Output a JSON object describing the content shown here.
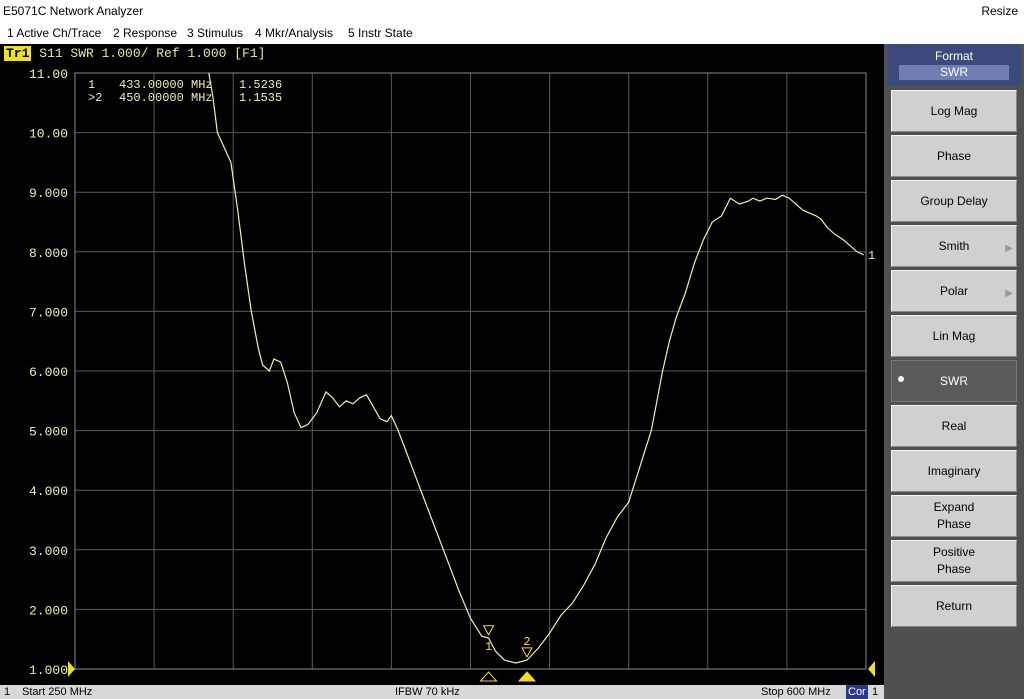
{
  "window": {
    "title": "E5071C Network Analyzer",
    "resize_label": "Resize"
  },
  "menu": [
    "1 Active Ch/Trace",
    "2 Response",
    "3 Stimulus",
    "4 Mkr/Analysis",
    "5 Instr State"
  ],
  "trace": {
    "badge": "Tr1",
    "label": "S11 SWR 1.000/ Ref 1.000 [F1]"
  },
  "markers": [
    {
      "prefix": "1",
      "freq": "433.00000 MHz",
      "value": "1.5236"
    },
    {
      "prefix": ">2",
      "freq": "450.00000 MHz",
      "value": "1.1535"
    }
  ],
  "marker_labels": [
    "1",
    "2"
  ],
  "trace_end_label": "1",
  "status": {
    "channel": "1",
    "start": "Start 250 MHz",
    "ifbw": "IFBW 70 kHz",
    "stop": "Stop 600 MHz",
    "cor": "Cor",
    "channel_end": "1"
  },
  "softkeys": {
    "title": "Format",
    "selected": "SWR",
    "items": [
      {
        "label": "Log Mag",
        "submenu": false,
        "active": false
      },
      {
        "label": "Phase",
        "submenu": false,
        "active": false
      },
      {
        "label": "Group Delay",
        "submenu": false,
        "active": false
      },
      {
        "label": "Smith",
        "submenu": true,
        "active": false
      },
      {
        "label": "Polar",
        "submenu": true,
        "active": false
      },
      {
        "label": "Lin Mag",
        "submenu": false,
        "active": false
      },
      {
        "label": "SWR",
        "submenu": false,
        "active": true
      },
      {
        "label": "Real",
        "submenu": false,
        "active": false
      },
      {
        "label": "Imaginary",
        "submenu": false,
        "active": false
      },
      {
        "label": "Expand\nPhase",
        "submenu": false,
        "active": false
      },
      {
        "label": "Positive\nPhase",
        "submenu": false,
        "active": false
      },
      {
        "label": "Return",
        "submenu": false,
        "active": false
      }
    ]
  },
  "colors": {
    "trace": "#f0f0b0",
    "grid": "#5a5a5a",
    "marker": "#f0e020",
    "background": "#000000"
  },
  "chart_data": {
    "type": "line",
    "xlim": [
      250,
      600
    ],
    "ylim": [
      1,
      11
    ],
    "y_ticks": [
      "1.000",
      "2.000",
      "3.000",
      "4.000",
      "5.000",
      "6.000",
      "7.000",
      "8.000",
      "9.000",
      "10.00",
      "11.00"
    ],
    "series": [
      {
        "x": [
          309,
          311,
          313,
          316,
          319,
          322,
          325,
          328,
          331,
          333,
          336,
          338,
          341,
          344,
          347,
          350,
          353,
          357,
          361,
          364,
          367,
          370,
          373,
          376,
          379,
          382,
          385,
          388,
          390,
          393,
          396,
          400,
          405,
          410,
          415,
          420,
          425,
          430,
          433,
          436,
          440,
          445,
          450,
          455,
          460,
          465,
          470,
          475,
          480,
          485,
          490,
          495,
          500,
          505,
          508,
          510,
          513,
          516,
          520,
          524,
          528,
          532,
          536,
          540,
          544,
          548,
          550,
          553,
          556,
          560,
          563,
          566,
          569,
          572,
          575,
          578,
          580,
          583,
          586,
          590,
          593,
          596,
          599
        ],
        "y": [
          11.05,
          10.6,
          10.0,
          9.75,
          9.5,
          8.7,
          7.8,
          7.0,
          6.4,
          6.1,
          6.0,
          6.2,
          6.15,
          5.8,
          5.3,
          5.05,
          5.1,
          5.3,
          5.65,
          5.55,
          5.4,
          5.5,
          5.45,
          5.55,
          5.6,
          5.4,
          5.2,
          5.15,
          5.25,
          5.0,
          4.7,
          4.3,
          3.8,
          3.3,
          2.8,
          2.3,
          1.85,
          1.55,
          1.52,
          1.3,
          1.15,
          1.1,
          1.15,
          1.35,
          1.6,
          1.9,
          2.1,
          2.4,
          2.75,
          3.2,
          3.55,
          3.8,
          4.4,
          5.0,
          5.6,
          6.0,
          6.5,
          6.9,
          7.3,
          7.8,
          8.2,
          8.5,
          8.6,
          8.9,
          8.8,
          8.85,
          8.9,
          8.85,
          8.9,
          8.88,
          8.95,
          8.9,
          8.8,
          8.7,
          8.65,
          8.6,
          8.55,
          8.4,
          8.3,
          8.2,
          8.1,
          8.0,
          7.95
        ]
      }
    ]
  }
}
